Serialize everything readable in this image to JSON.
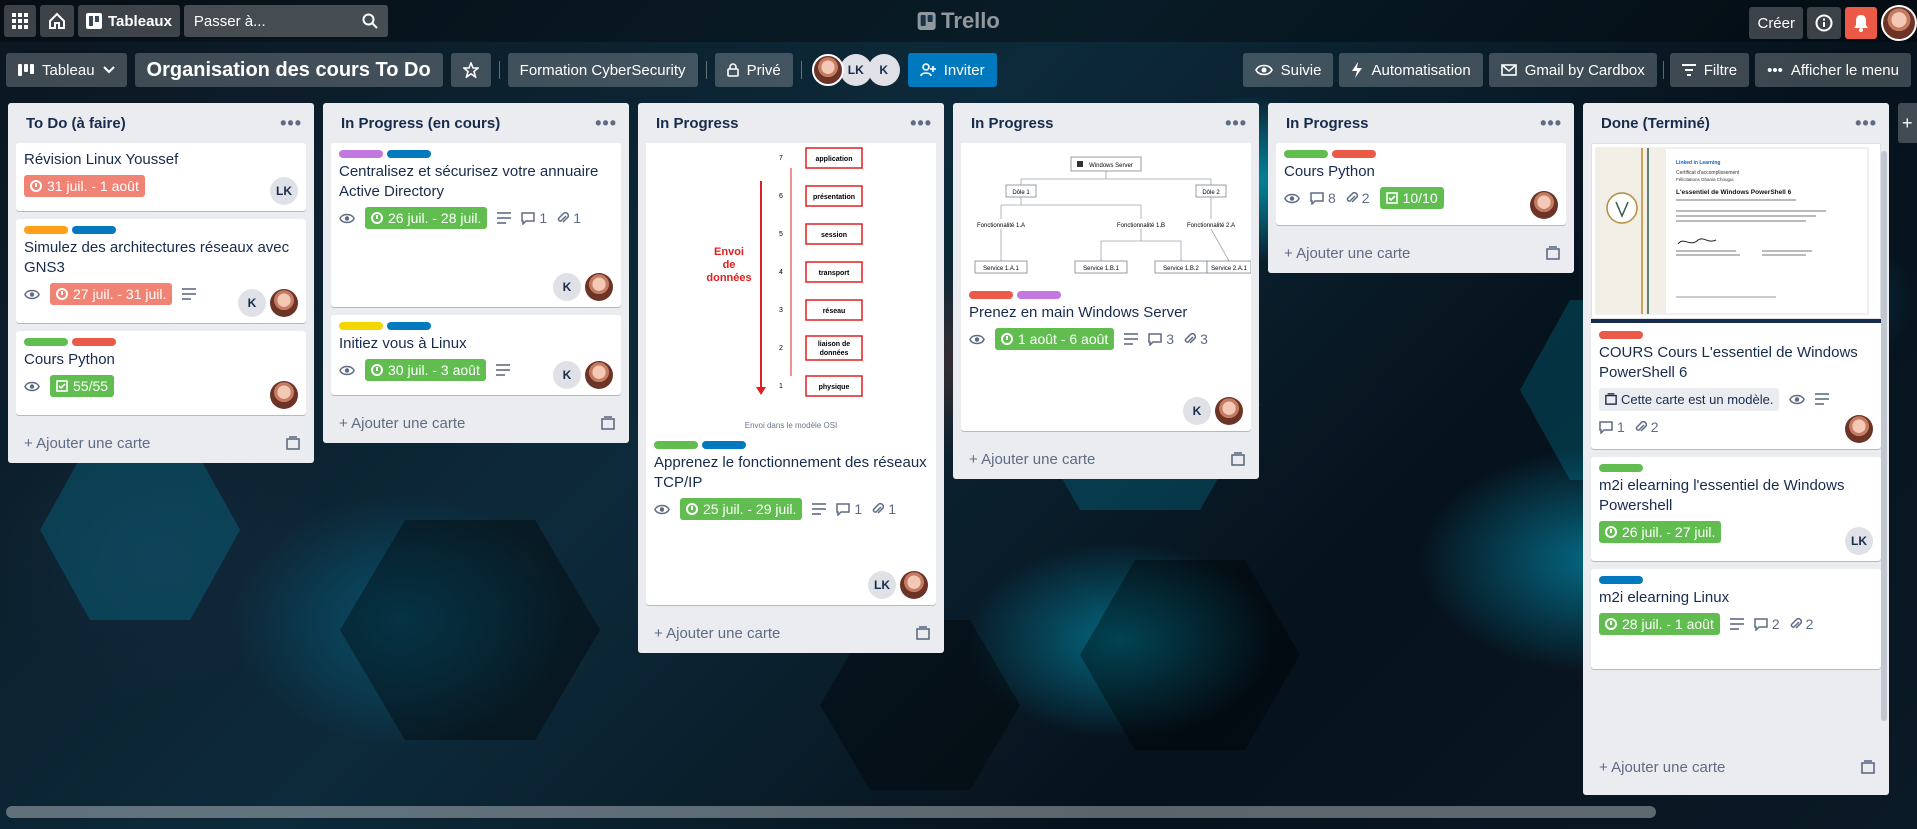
{
  "topbar": {
    "boards_label": "Tableaux",
    "search_placeholder": "Passer à...",
    "app_name": "Trello",
    "create_label": "Créer"
  },
  "board": {
    "view_label": "Tableau",
    "title": "Organisation des cours To Do",
    "workspace": "Formation CyberSecurity",
    "visibility": "Privé",
    "member_initials": [
      "LK",
      "K"
    ],
    "invite_label": "Inviter",
    "follow_label": "Suivie",
    "automation_label": "Automatisation",
    "gmail_label": "Gmail by Cardbox",
    "filter_label": "Filtre",
    "menu_label": "Afficher le menu"
  },
  "add_card_label": "Ajouter une carte",
  "colors": {
    "green": "#61bd4f",
    "red": "#eb5a46",
    "orange": "#ff9f1a",
    "blue": "#0079bf",
    "purple": "#c377e0",
    "yellow": "#f2d600"
  },
  "lists": [
    {
      "title": "To Do (à faire)",
      "cards": [
        {
          "title": "Révision Linux Youssef",
          "date": "31 juil. - 1 août",
          "member": "LK"
        },
        {
          "title": "Simulez des architectures réseaux avec GNS3",
          "date": "27 juil. - 31 juil.",
          "member": "K"
        },
        {
          "title": "Cours Python",
          "checklist": "55/55"
        }
      ]
    },
    {
      "title": "In Progress (en cours)",
      "cards": [
        {
          "title": "Centralisez et sécurisez votre annuaire Active Directory",
          "date": "26 juil. - 28 juil.",
          "comments": "1",
          "attachments": "1",
          "member": "K"
        },
        {
          "title": "Initiez vous à Linux",
          "date": "30 juil. - 3 août",
          "member": "K"
        }
      ]
    },
    {
      "title": "In Progress",
      "cards": [
        {
          "title": "Apprenez le fonctionnement des réseaux TCP/IP",
          "date": "25 juil. - 29 juil.",
          "comments": "1",
          "attachments": "1",
          "member": "LK",
          "cover": {
            "side_label": "Envoi de données",
            "caption": "Envoi dans le modèle OSI",
            "layers": [
              {
                "n": "7",
                "name": "application"
              },
              {
                "n": "6",
                "name": "présentation"
              },
              {
                "n": "5",
                "name": "session"
              },
              {
                "n": "4",
                "name": "transport"
              },
              {
                "n": "3",
                "name": "réseau"
              },
              {
                "n": "2",
                "name": "liaison de données"
              },
              {
                "n": "1",
                "name": "physique"
              }
            ]
          }
        }
      ]
    },
    {
      "title": "In Progress",
      "cards": [
        {
          "title": "Prenez en main Windows Server",
          "date": "1 août - 6 août",
          "comments": "3",
          "attachments": "3",
          "member": "K",
          "cover": {
            "root": "Windows Server",
            "level1": [
              "Dôle 1",
              "Dôle 2"
            ],
            "level2": [
              "Fonctionnalité 1.A",
              "Fonctionnalité 1.B",
              "Fonctionnalité 2.A"
            ],
            "level3": [
              "Service 1.A.1",
              "Service 1.B.1",
              "Service 1.B.2",
              "Service 2.A.1"
            ]
          }
        }
      ]
    },
    {
      "title": "In Progress",
      "cards": [
        {
          "title": "Cours Python",
          "comments": "8",
          "attachments": "2",
          "checklist": "10/10"
        }
      ]
    },
    {
      "title": "Done (Terminé)",
      "cards": [
        {
          "title": "COURS Cours L'essentiel de Windows PowerShell 6",
          "template_label": "Cette carte est un modèle.",
          "comments": "1",
          "attachments": "2",
          "cover": {
            "brand": "Linked in Learning",
            "heading": "Certificat d'accomplissement",
            "subheading": "Félicitations Ghania Chougui",
            "course": "L'essentiel de Windows PowerShell 6"
          }
        },
        {
          "title": "m2i elearning l'essentiel de Windows Powershell",
          "date": "26 juil. - 27 juil.",
          "member": "LK"
        },
        {
          "title": "m2i elearning Linux",
          "date": "28 juil. - 1 août",
          "comments": "2",
          "attachments": "2"
        }
      ]
    }
  ]
}
